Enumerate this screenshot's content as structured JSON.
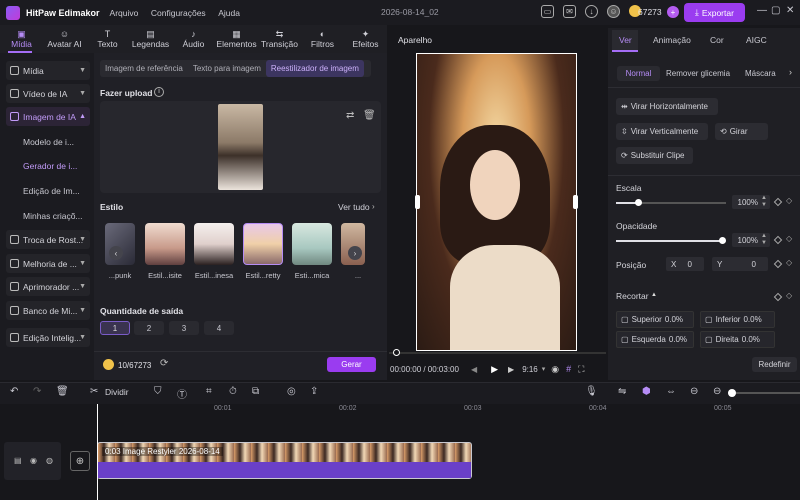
{
  "titlebar": {
    "app_name": "HitPaw Edimakor",
    "menu": [
      "Arquivo",
      "Configurações",
      "Ajuda"
    ],
    "project_title": "2026-08-14_02",
    "coins": "67273",
    "export_label": "Exportar",
    "colors": {
      "accent": "#9a3cf0"
    }
  },
  "top_tabs": [
    {
      "label": "Mídia",
      "icon": "media-icon"
    },
    {
      "label": "Avatar AI",
      "icon": "avatar-icon"
    },
    {
      "label": "Texto",
      "icon": "text-icon"
    },
    {
      "label": "Legendas",
      "icon": "captions-icon"
    },
    {
      "label": "Áudio",
      "icon": "audio-icon"
    },
    {
      "label": "Elementos",
      "icon": "elements-icon"
    },
    {
      "label": "Transição",
      "icon": "transition-icon"
    },
    {
      "label": "Filtros",
      "icon": "filters-icon"
    },
    {
      "label": "Efeitos",
      "icon": "effects-icon"
    }
  ],
  "sidebar": {
    "items": [
      {
        "label": "Mídia"
      },
      {
        "label": "Vídeo de IA"
      },
      {
        "label": "Imagem de IA"
      },
      {
        "label": "Troca de Rost..."
      },
      {
        "label": "Melhoria de ..."
      },
      {
        "label": "Aprimorador ..."
      },
      {
        "label": "Banco de Mi..."
      },
      {
        "label": "Edição Intelig..."
      }
    ],
    "subitems": [
      "Modelo de i...",
      "Gerador de i...",
      "Edição de Im...",
      "Minhas criaçõ..."
    ]
  },
  "ai_image": {
    "subtabs": [
      "Imagem de referência",
      "Texto para imagem",
      "Reestilizador de imagem"
    ],
    "upload_label": "Fazer upload",
    "style_label": "Estilo",
    "see_all": "Ver tudo",
    "styles": [
      "...punk",
      "Estil...isite",
      "Estil...inesa",
      "Estil...retty",
      "Esti...mica",
      "..."
    ],
    "quantity_label": "Quantidade de saída",
    "quantities": [
      "1",
      "2",
      "3",
      "4"
    ],
    "credits": "10/67273",
    "generate_label": "Gerar"
  },
  "player": {
    "title": "Aparelho",
    "time": "00:00:00 / 00:03:00",
    "ratio": "9:16"
  },
  "right_panel": {
    "tabs": [
      "Ver",
      "Animação",
      "Cor",
      "AIGC"
    ],
    "subtabs": [
      "Normal",
      "Remover glicemia",
      "Máscara"
    ],
    "flip_h": "Virar Horizontalmente",
    "flip_v": "Virar Verticalmente",
    "rotate": "Girar",
    "replace_clip": "Substituir Clipe",
    "scale_label": "Escala",
    "scale_value": "100%",
    "opacity_label": "Opacidade",
    "opacity_value": "100%",
    "position_label": "Posição",
    "pos_x_label": "X",
    "pos_x": "0",
    "pos_y_label": "Y",
    "pos_y": "0",
    "crop_label": "Recortar",
    "crop": [
      {
        "label": "Superior",
        "value": "0.0%"
      },
      {
        "label": "Inferior",
        "value": "0.0%"
      },
      {
        "label": "Esquerda",
        "value": "0.0%"
      },
      {
        "label": "Direita",
        "value": "0.0%"
      }
    ],
    "reset_label": "Redefinir"
  },
  "timeline": {
    "split_label": "Dividir",
    "ticks": [
      "00:01",
      "00:02",
      "00:03",
      "00:04",
      "00:05"
    ],
    "clip_label": "0:03 Image Restyler 2026-08-14"
  }
}
